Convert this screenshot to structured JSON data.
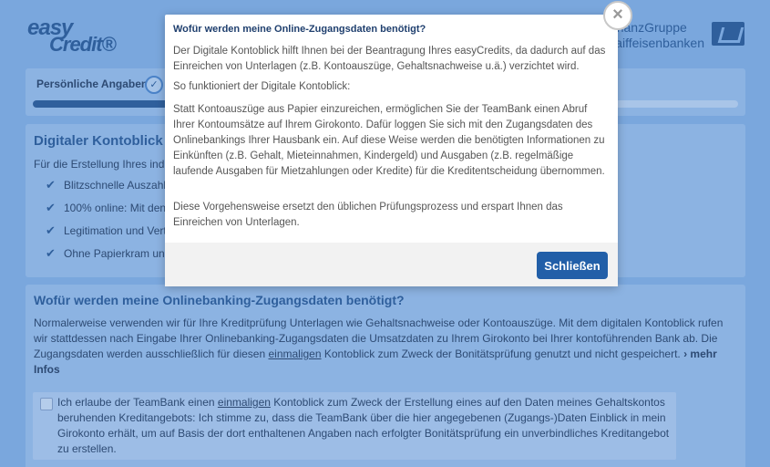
{
  "header": {
    "logo_line1": "easy",
    "logo_line2": "Credit®",
    "brand_line1": "FinanzGruppe",
    "brand_line2": "Raiffeisenbanken"
  },
  "progress": {
    "step_label": "Persönliche Angaben",
    "check": "✓",
    "fill_fraction": 0.26
  },
  "card1": {
    "title": "Digitaler Kontoblick",
    "intro": "Für die Erstellung Ihres indiv",
    "items": [
      "Blitzschnelle Auszahl",
      "100% online: Mit den",
      "Legitimation und Vert",
      "Ohne Papierkram und"
    ]
  },
  "card2": {
    "title": "Wofür werden meine Onlinebanking-Zugangsdaten benötigt?",
    "para_a": "Normalerweise verwenden wir für Ihre Kreditprüfung Unterlagen wie Gehaltsnachweise oder Kontoauszüge. Mit dem digitalen Kontoblick rufen wir stattdessen nach Eingabe Ihrer Onlinebanking-Zugangsdaten die Umsatzdaten zu Ihrem Girokonto bei Ihrer kontoführenden Bank ab. Die Zugangsdaten werden ausschließlich für diesen ",
    "para_link": "einmaligen",
    "para_b": " Kontoblick zum Zweck der Bonitätsprüfung genutzt und nicht gespeichert. ",
    "more": "› mehr Infos",
    "consent_a": "Ich erlaube der TeamBank einen ",
    "consent_link": "einmaligen",
    "consent_b": " Kontoblick zum Zweck der Erstellung eines auf den Daten meines Gehaltskontos beruhenden Kreditangebots: Ich stimme zu, dass die TeamBank über die hier angegebenen (Zugangs-)Daten Einblick in mein Girokonto erhält, um auf Basis der dort enthaltenen Angaben nach erfolgter Bonitätsprüfung ein unverbindliches Kreditangebot zu erstellen."
  },
  "modal": {
    "title": "Wofür werden meine Online-Zugangsdaten benötigt?",
    "p1": "Der Digitale Kontoblick hilft Ihnen bei der Beantragung Ihres easyCredits, da dadurch auf das Einreichen von Unterlagen (z.B. Kontoauszüge, Gehaltsnachweise u.ä.) verzichtet wird.",
    "p2": "So funktioniert der Digitale Kontoblick:",
    "p3": "Statt Kontoauszüge aus Papier einzureichen, ermöglichen Sie der TeamBank einen Abruf Ihrer Kontoumsätze auf Ihrem Girokonto. Dafür loggen Sie sich mit den Zugangsdaten des Onlinebankings Ihrer Hausbank ein. Auf diese Weise werden die benötigten Informationen zu Einkünften (z.B. Gehalt, Mieteinnahmen, Kindergeld) und Ausgaben (z.B. regelmäßige laufende Ausgaben für Mietzahlungen oder Kredite) für die Kreditentscheidung übernommen.",
    "p4": "Diese Vorgehensweise ersetzt den üblichen Prüfungsprozess und erspart Ihnen das Einreichen von Unterlagen.",
    "close_label": "Schließen",
    "close_x": "×"
  }
}
